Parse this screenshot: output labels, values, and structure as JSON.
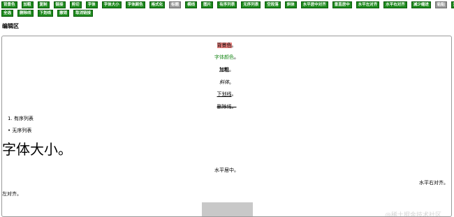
{
  "toolbar": {
    "row1": [
      {
        "label": "背景色",
        "style": "green"
      },
      {
        "label": "加粗",
        "style": "green"
      },
      {
        "label": "复制",
        "style": "green"
      },
      {
        "label": "链接",
        "style": "green"
      },
      {
        "label": "剪切",
        "style": "green"
      },
      {
        "label": "字体",
        "style": "green"
      },
      {
        "label": "字体大小",
        "style": "green"
      },
      {
        "label": "字体颜色",
        "style": "green"
      },
      {
        "label": "格式化",
        "style": "green"
      },
      {
        "label": "标题",
        "style": "gray"
      },
      {
        "label": "横线",
        "style": "green"
      },
      {
        "label": "图片",
        "style": "green"
      },
      {
        "label": "有序列表",
        "style": "green"
      },
      {
        "label": "无序列表",
        "style": "green"
      },
      {
        "label": "空段落",
        "style": "green"
      },
      {
        "label": "斜体",
        "style": "green"
      },
      {
        "label": "水平居中对齐",
        "style": "green"
      },
      {
        "label": "垂直居中",
        "style": "green"
      },
      {
        "label": "水平左对齐",
        "style": "green"
      },
      {
        "label": "水平右对齐",
        "style": "green"
      },
      {
        "label": "减少缩进",
        "style": "green"
      },
      {
        "label": "粘贴",
        "style": "gray"
      },
      {
        "label": "重做",
        "style": "green"
      }
    ],
    "row2": [
      {
        "label": "全选",
        "style": "green"
      },
      {
        "label": "删除线",
        "style": "green"
      },
      {
        "label": "下划线",
        "style": "green"
      },
      {
        "label": "撤销",
        "style": "green"
      },
      {
        "label": "取消链接",
        "style": "green"
      }
    ]
  },
  "section_title": "编辑区",
  "editor": {
    "bg_color_text": "背景色",
    "font_color_text": "字体颜色",
    "bold_text": "加粗",
    "italic_text": "斜体",
    "underline_text": "下划线",
    "strike_text": "删除线",
    "period": "。",
    "ordered_list_marker": "1.",
    "ordered_list_item": "有序列表",
    "unordered_list_marker": "•",
    "unordered_list_item": "无序列表",
    "font_size_text": "字体大小。",
    "center_text": "水平居中。",
    "right_text": "水平右对齐。",
    "left_text": "左对齐。"
  },
  "watermark": "@稀土掘金技术社区",
  "colors": {
    "button_green": "#1d8a1d",
    "button_gray": "#9a9a9a",
    "highlight_red": "#e8817f",
    "font_green": "#1d8a1d"
  }
}
